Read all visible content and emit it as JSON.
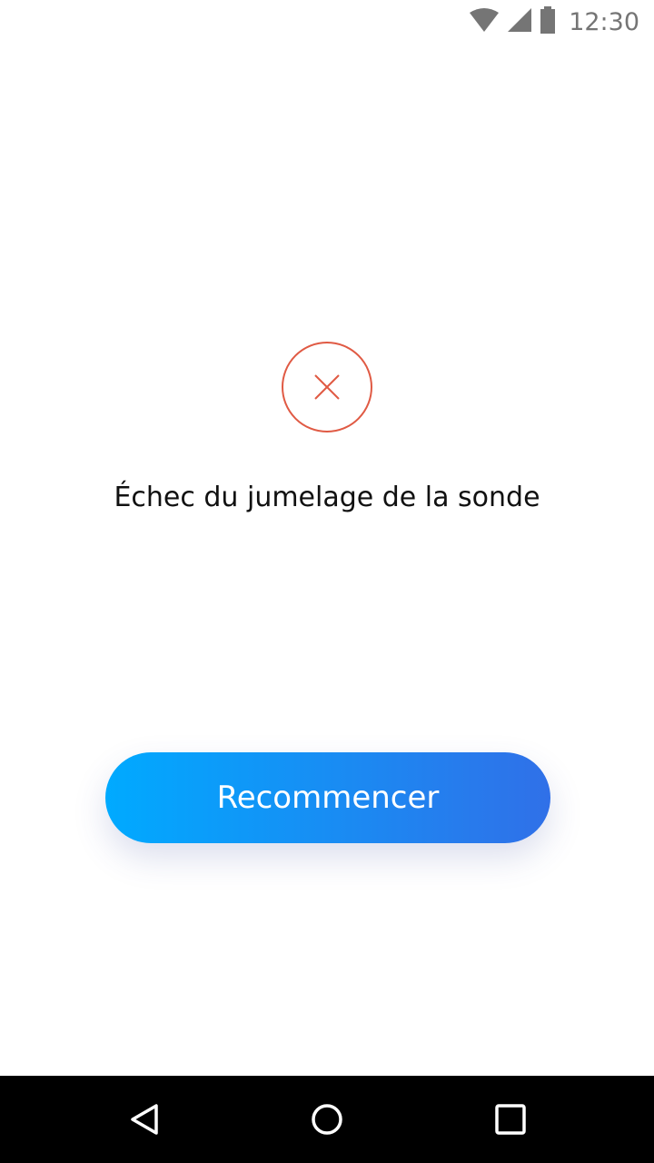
{
  "status_bar": {
    "time": "12:30",
    "icons": [
      "wifi-icon",
      "cell-signal-icon",
      "battery-icon"
    ]
  },
  "error": {
    "icon": "close-icon",
    "message": "Échec du jumelage de la sonde",
    "accent_color": "#e05a44"
  },
  "actions": {
    "restart_label": "Recommencer",
    "gradient_start": "#00aaff",
    "gradient_end": "#3070e8"
  },
  "nav_bar": {
    "buttons": [
      "back-icon",
      "home-icon",
      "recents-icon"
    ]
  }
}
